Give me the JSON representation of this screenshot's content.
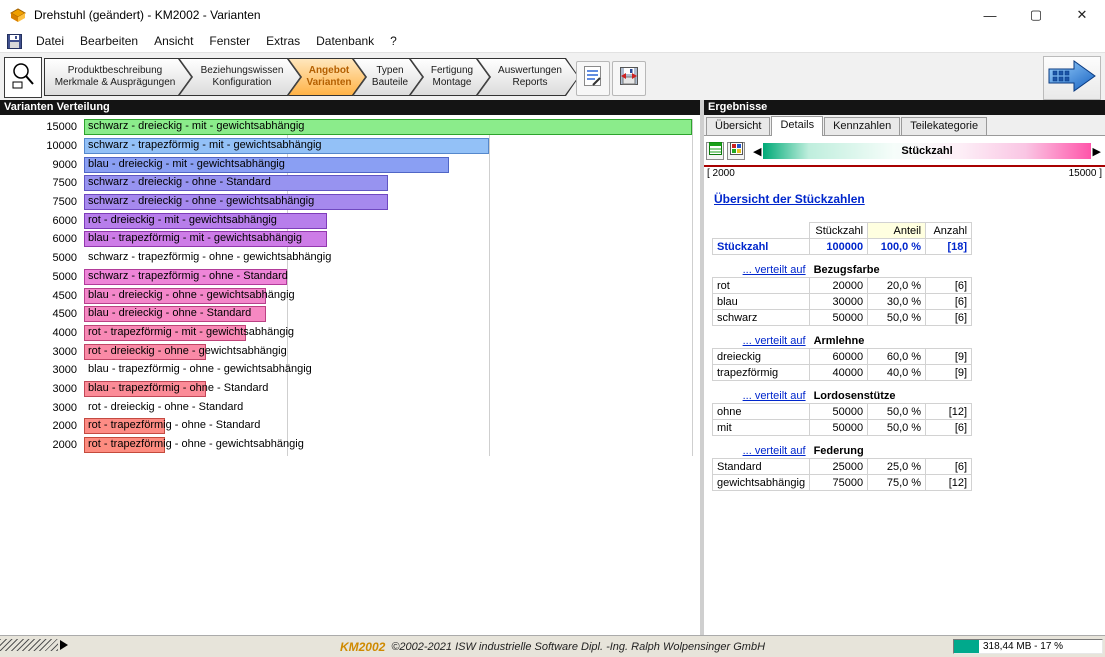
{
  "window": {
    "title": "Drehstuhl (geändert) - KM2002 - Varianten",
    "controls": {
      "minimize": "—",
      "maximize": "▢",
      "close": "✕"
    }
  },
  "menu": {
    "items": [
      "Datei",
      "Bearbeiten",
      "Ansicht",
      "Fenster",
      "Extras",
      "Datenbank",
      "?"
    ]
  },
  "toolbar": {
    "tabs": [
      {
        "line1": "Produktbeschreibung",
        "line2": "Merkmale & Ausprägungen",
        "active": false
      },
      {
        "line1": "Beziehungswissen",
        "line2": "Konfiguration",
        "active": false
      },
      {
        "line1": "Angebot",
        "line2": "Varianten",
        "active": true
      },
      {
        "line1": "Typen",
        "line2": "Bauteile",
        "active": false
      },
      {
        "line1": "Fertigung",
        "line2": "Montage",
        "active": false
      },
      {
        "line1": "Auswertungen",
        "line2": "Reports",
        "active": false
      }
    ]
  },
  "left_panel": {
    "header": "Varianten Verteilung"
  },
  "chart_data": {
    "type": "bar",
    "orientation": "horizontal",
    "title": "Varianten Verteilung",
    "x_max": 15000,
    "gridlines": [
      5000,
      10000,
      15000
    ],
    "rows": [
      {
        "value": 15000,
        "label": "schwarz - dreieckig - mit - gewichtsabhängig",
        "fill": "#8bec8b",
        "edge": "#2da32d"
      },
      {
        "value": 10000,
        "label": "schwarz - trapezförmig - mit - gewichtsabhängig",
        "fill": "#93c1f7",
        "edge": "#5588cc"
      },
      {
        "value": 9000,
        "label": "blau - dreieckig - mit - gewichtsabhängig",
        "fill": "#8a9ff3",
        "edge": "#5066c6"
      },
      {
        "value": 7500,
        "label": "schwarz - dreieckig - ohne - Standard",
        "fill": "#9793f0",
        "edge": "#6156c2"
      },
      {
        "value": 7500,
        "label": "schwarz - dreieckig - ohne - gewichtsabhängig",
        "fill": "#a689ee",
        "edge": "#6f48c0"
      },
      {
        "value": 6000,
        "label": "rot - dreieckig - mit - gewichtsabhängig",
        "fill": "#b77eeb",
        "edge": "#7e3cba"
      },
      {
        "value": 6000,
        "label": "blau - trapezförmig - mit - gewichtsabhängig",
        "fill": "#cd7ce7",
        "edge": "#9338ae"
      },
      {
        "value": 5000,
        "label": "schwarz - trapezförmig - ohne - gewichtsabhängig",
        "fill": null,
        "edge": null
      },
      {
        "value": 5000,
        "label": "schwarz - trapezförmig - ohne - Standard",
        "fill": "#ee85d8",
        "edge": "#b23b9a"
      },
      {
        "value": 4500,
        "label": "blau - dreieckig - ohne - gewichtsabhängig",
        "fill": "#f387ca",
        "edge": "#b83f8d"
      },
      {
        "value": 4500,
        "label": "blau - dreieckig - ohne - Standard",
        "fill": "#f688c2",
        "edge": "#bb4184"
      },
      {
        "value": 4000,
        "label": "rot - trapezförmig - mit - gewichtsabhängig",
        "fill": "#f889b5",
        "edge": "#be4378"
      },
      {
        "value": 3000,
        "label": "rot - dreieckig - ohne - gewichtsabhängig",
        "fill": "#fa8aa6",
        "edge": "#c04566"
      },
      {
        "value": 3000,
        "label": "blau - trapezförmig - ohne - gewichtsabhängig",
        "fill": null,
        "edge": null
      },
      {
        "value": 3000,
        "label": "blau - trapezförmig - ohne - Standard",
        "fill": "#fb8b97",
        "edge": "#c24757"
      },
      {
        "value": 3000,
        "label": "rot - dreieckig - ohne - Standard",
        "fill": null,
        "edge": null
      },
      {
        "value": 2000,
        "label": "rot - trapezförmig - ohne - Standard",
        "fill": "#fd8c85",
        "edge": "#c44a42"
      },
      {
        "value": 2000,
        "label": "rot - trapezförmig - ohne - gewichtsabhängig",
        "fill": "#fd8c80",
        "edge": "#c44a3c"
      }
    ]
  },
  "right_panel": {
    "header": "Ergebnisse",
    "tabs": [
      {
        "label": "Übersicht",
        "active": false
      },
      {
        "label": "Details",
        "active": true
      },
      {
        "label": "Kennzahlen",
        "active": false
      },
      {
        "label": "Teilekategorie",
        "active": false
      }
    ],
    "slider": {
      "left_arrow": "◀",
      "right_arrow": "▶",
      "label": "Stückzahl",
      "range_min": "[ 2000",
      "range_max": "15000 ]",
      "gradient_left": "#00aa77",
      "gradient_right": "#ff55aa"
    },
    "link": "Übersicht der Stückzahlen",
    "table": {
      "headers": [
        "Stückzahl",
        "Anteil",
        "Anzahl"
      ],
      "total": {
        "label": "Stückzahl",
        "value": "100000",
        "share": "100,0 %",
        "count": "[18]"
      },
      "group_prefix": "... verteilt auf",
      "groups": [
        {
          "name": "Bezugsfarbe",
          "rows": [
            {
              "label": "rot",
              "value": "20000",
              "share": "20,0 %",
              "count": "[6]"
            },
            {
              "label": "blau",
              "value": "30000",
              "share": "30,0 %",
              "count": "[6]"
            },
            {
              "label": "schwarz",
              "value": "50000",
              "share": "50,0 %",
              "count": "[6]"
            }
          ]
        },
        {
          "name": "Armlehne",
          "rows": [
            {
              "label": "dreieckig",
              "value": "60000",
              "share": "60,0 %",
              "count": "[9]"
            },
            {
              "label": "trapezförmig",
              "value": "40000",
              "share": "40,0 %",
              "count": "[9]"
            }
          ]
        },
        {
          "name": "Lordosenstütze",
          "rows": [
            {
              "label": "ohne",
              "value": "50000",
              "share": "50,0 %",
              "count": "[12]"
            },
            {
              "label": "mit",
              "value": "50000",
              "share": "50,0 %",
              "count": "[6]"
            }
          ]
        },
        {
          "name": "Federung",
          "rows": [
            {
              "label": "Standard",
              "value": "25000",
              "share": "25,0 %",
              "count": "[6]"
            },
            {
              "label": "gewichtsabhängig",
              "value": "75000",
              "share": "75,0 %",
              "count": "[12]"
            }
          ]
        }
      ]
    }
  },
  "status_bar": {
    "brand": "KM2002",
    "copyright": "©2002-2021 ISW industrielle Software Dipl. -Ing. Ralph Wolpensinger GmbH",
    "memory": "318,44 MB - 17 %"
  }
}
